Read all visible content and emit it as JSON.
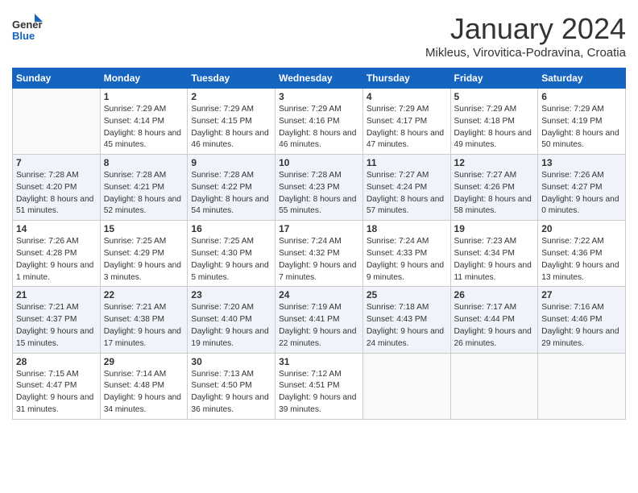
{
  "header": {
    "logo_general": "General",
    "logo_blue": "Blue",
    "month_title": "January 2024",
    "location": "Mikleus, Virovitica-Podravina, Croatia"
  },
  "days_of_week": [
    "Sunday",
    "Monday",
    "Tuesday",
    "Wednesday",
    "Thursday",
    "Friday",
    "Saturday"
  ],
  "weeks": [
    [
      {
        "day": "",
        "sunrise": "",
        "sunset": "",
        "daylight": ""
      },
      {
        "day": "1",
        "sunrise": "Sunrise: 7:29 AM",
        "sunset": "Sunset: 4:14 PM",
        "daylight": "Daylight: 8 hours and 45 minutes."
      },
      {
        "day": "2",
        "sunrise": "Sunrise: 7:29 AM",
        "sunset": "Sunset: 4:15 PM",
        "daylight": "Daylight: 8 hours and 46 minutes."
      },
      {
        "day": "3",
        "sunrise": "Sunrise: 7:29 AM",
        "sunset": "Sunset: 4:16 PM",
        "daylight": "Daylight: 8 hours and 46 minutes."
      },
      {
        "day": "4",
        "sunrise": "Sunrise: 7:29 AM",
        "sunset": "Sunset: 4:17 PM",
        "daylight": "Daylight: 8 hours and 47 minutes."
      },
      {
        "day": "5",
        "sunrise": "Sunrise: 7:29 AM",
        "sunset": "Sunset: 4:18 PM",
        "daylight": "Daylight: 8 hours and 49 minutes."
      },
      {
        "day": "6",
        "sunrise": "Sunrise: 7:29 AM",
        "sunset": "Sunset: 4:19 PM",
        "daylight": "Daylight: 8 hours and 50 minutes."
      }
    ],
    [
      {
        "day": "7",
        "sunrise": "Sunrise: 7:28 AM",
        "sunset": "Sunset: 4:20 PM",
        "daylight": "Daylight: 8 hours and 51 minutes."
      },
      {
        "day": "8",
        "sunrise": "Sunrise: 7:28 AM",
        "sunset": "Sunset: 4:21 PM",
        "daylight": "Daylight: 8 hours and 52 minutes."
      },
      {
        "day": "9",
        "sunrise": "Sunrise: 7:28 AM",
        "sunset": "Sunset: 4:22 PM",
        "daylight": "Daylight: 8 hours and 54 minutes."
      },
      {
        "day": "10",
        "sunrise": "Sunrise: 7:28 AM",
        "sunset": "Sunset: 4:23 PM",
        "daylight": "Daylight: 8 hours and 55 minutes."
      },
      {
        "day": "11",
        "sunrise": "Sunrise: 7:27 AM",
        "sunset": "Sunset: 4:24 PM",
        "daylight": "Daylight: 8 hours and 57 minutes."
      },
      {
        "day": "12",
        "sunrise": "Sunrise: 7:27 AM",
        "sunset": "Sunset: 4:26 PM",
        "daylight": "Daylight: 8 hours and 58 minutes."
      },
      {
        "day": "13",
        "sunrise": "Sunrise: 7:26 AM",
        "sunset": "Sunset: 4:27 PM",
        "daylight": "Daylight: 9 hours and 0 minutes."
      }
    ],
    [
      {
        "day": "14",
        "sunrise": "Sunrise: 7:26 AM",
        "sunset": "Sunset: 4:28 PM",
        "daylight": "Daylight: 9 hours and 1 minute."
      },
      {
        "day": "15",
        "sunrise": "Sunrise: 7:25 AM",
        "sunset": "Sunset: 4:29 PM",
        "daylight": "Daylight: 9 hours and 3 minutes."
      },
      {
        "day": "16",
        "sunrise": "Sunrise: 7:25 AM",
        "sunset": "Sunset: 4:30 PM",
        "daylight": "Daylight: 9 hours and 5 minutes."
      },
      {
        "day": "17",
        "sunrise": "Sunrise: 7:24 AM",
        "sunset": "Sunset: 4:32 PM",
        "daylight": "Daylight: 9 hours and 7 minutes."
      },
      {
        "day": "18",
        "sunrise": "Sunrise: 7:24 AM",
        "sunset": "Sunset: 4:33 PM",
        "daylight": "Daylight: 9 hours and 9 minutes."
      },
      {
        "day": "19",
        "sunrise": "Sunrise: 7:23 AM",
        "sunset": "Sunset: 4:34 PM",
        "daylight": "Daylight: 9 hours and 11 minutes."
      },
      {
        "day": "20",
        "sunrise": "Sunrise: 7:22 AM",
        "sunset": "Sunset: 4:36 PM",
        "daylight": "Daylight: 9 hours and 13 minutes."
      }
    ],
    [
      {
        "day": "21",
        "sunrise": "Sunrise: 7:21 AM",
        "sunset": "Sunset: 4:37 PM",
        "daylight": "Daylight: 9 hours and 15 minutes."
      },
      {
        "day": "22",
        "sunrise": "Sunrise: 7:21 AM",
        "sunset": "Sunset: 4:38 PM",
        "daylight": "Daylight: 9 hours and 17 minutes."
      },
      {
        "day": "23",
        "sunrise": "Sunrise: 7:20 AM",
        "sunset": "Sunset: 4:40 PM",
        "daylight": "Daylight: 9 hours and 19 minutes."
      },
      {
        "day": "24",
        "sunrise": "Sunrise: 7:19 AM",
        "sunset": "Sunset: 4:41 PM",
        "daylight": "Daylight: 9 hours and 22 minutes."
      },
      {
        "day": "25",
        "sunrise": "Sunrise: 7:18 AM",
        "sunset": "Sunset: 4:43 PM",
        "daylight": "Daylight: 9 hours and 24 minutes."
      },
      {
        "day": "26",
        "sunrise": "Sunrise: 7:17 AM",
        "sunset": "Sunset: 4:44 PM",
        "daylight": "Daylight: 9 hours and 26 minutes."
      },
      {
        "day": "27",
        "sunrise": "Sunrise: 7:16 AM",
        "sunset": "Sunset: 4:46 PM",
        "daylight": "Daylight: 9 hours and 29 minutes."
      }
    ],
    [
      {
        "day": "28",
        "sunrise": "Sunrise: 7:15 AM",
        "sunset": "Sunset: 4:47 PM",
        "daylight": "Daylight: 9 hours and 31 minutes."
      },
      {
        "day": "29",
        "sunrise": "Sunrise: 7:14 AM",
        "sunset": "Sunset: 4:48 PM",
        "daylight": "Daylight: 9 hours and 34 minutes."
      },
      {
        "day": "30",
        "sunrise": "Sunrise: 7:13 AM",
        "sunset": "Sunset: 4:50 PM",
        "daylight": "Daylight: 9 hours and 36 minutes."
      },
      {
        "day": "31",
        "sunrise": "Sunrise: 7:12 AM",
        "sunset": "Sunset: 4:51 PM",
        "daylight": "Daylight: 9 hours and 39 minutes."
      },
      {
        "day": "",
        "sunrise": "",
        "sunset": "",
        "daylight": ""
      },
      {
        "day": "",
        "sunrise": "",
        "sunset": "",
        "daylight": ""
      },
      {
        "day": "",
        "sunrise": "",
        "sunset": "",
        "daylight": ""
      }
    ]
  ]
}
